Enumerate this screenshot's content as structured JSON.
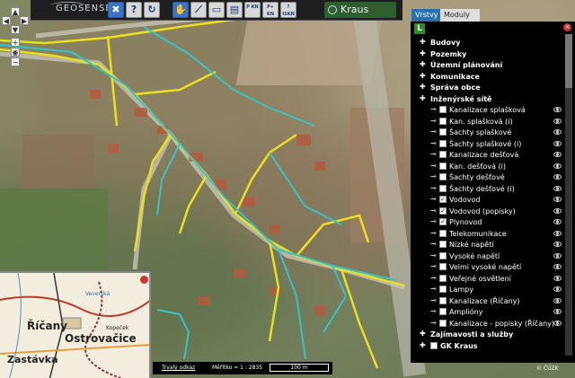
{
  "toolbar": {
    "logo": "GEOSENSE",
    "brand": "Kraus",
    "buttons": [
      {
        "name": "tools-button",
        "label": "✖"
      },
      {
        "name": "help-button",
        "label": "?"
      },
      {
        "name": "refresh-button",
        "label": "↻"
      },
      {
        "name": "pan-button",
        "label": "✋"
      },
      {
        "name": "measure-button",
        "label": "⟋"
      },
      {
        "name": "area-button",
        "label": "▭"
      },
      {
        "name": "print-button",
        "label": "▤"
      },
      {
        "name": "parcel-kn-button",
        "label": "P KN"
      },
      {
        "name": "parcel-plus-kn-button",
        "label": "P+ KN"
      },
      {
        "name": "iskn-button",
        "label": "? ISKN"
      }
    ]
  },
  "tabs": {
    "layers": "Vrstvy",
    "modules": "Moduly"
  },
  "panel": {
    "rows": [
      {
        "label": "Budovy",
        "level": 0,
        "bold": true
      },
      {
        "label": "Pozemky",
        "level": 0,
        "bold": true
      },
      {
        "label": "Územní plánování",
        "level": 0,
        "bold": true
      },
      {
        "label": "Komunikace",
        "level": 0,
        "bold": true
      },
      {
        "label": "Správa obce",
        "level": 0,
        "bold": true
      },
      {
        "label": "Inženýrské sítě",
        "level": 1,
        "bold": true
      },
      {
        "label": "Kanalizace splašková",
        "level": 2,
        "checked": false,
        "eye": true
      },
      {
        "label": "Kan. splašková (i)",
        "level": 2,
        "checked": false,
        "eye": true
      },
      {
        "label": "Šachty splaškové",
        "level": 2,
        "checked": false,
        "eye": true
      },
      {
        "label": "Šachty splaškové (i)",
        "level": 2,
        "checked": false,
        "eye": true
      },
      {
        "label": "Kanalizace dešťová",
        "level": 2,
        "checked": false,
        "eye": true
      },
      {
        "label": "Kan. dešťová (i)",
        "level": 2,
        "checked": false,
        "eye": true
      },
      {
        "label": "Šachty dešťové",
        "level": 2,
        "checked": false,
        "eye": true
      },
      {
        "label": "Šachty dešťové (i)",
        "level": 2,
        "checked": false,
        "eye": true
      },
      {
        "label": "Vodovod",
        "level": 2,
        "checked": true,
        "eye": true
      },
      {
        "label": "Vodovod (popisky)",
        "level": 2,
        "checked": true,
        "eye": true
      },
      {
        "label": "Plynovod",
        "level": 2,
        "checked": true,
        "eye": true
      },
      {
        "label": "Telekomunikace",
        "level": 2,
        "checked": false,
        "eye": true
      },
      {
        "label": "Nízké napětí",
        "level": 2,
        "checked": false,
        "eye": true
      },
      {
        "label": "Vysoké napětí",
        "level": 2,
        "checked": false,
        "eye": true
      },
      {
        "label": "Velmi vysoké napětí",
        "level": 2,
        "checked": false,
        "eye": true
      },
      {
        "label": "Veřejné osvětlení",
        "level": 2,
        "checked": false,
        "eye": true
      },
      {
        "label": "Lampy",
        "level": 2,
        "checked": false,
        "eye": true
      },
      {
        "label": "Kanalizace (Říčany)",
        "level": 2,
        "checked": false,
        "eye": true
      },
      {
        "label": "Amplióny",
        "level": 2,
        "checked": false,
        "eye": true
      },
      {
        "label": "Kanalizace - popisky (Říčany)",
        "level": 2,
        "checked": false,
        "eye": true
      },
      {
        "label": "Zajímavosti a služby",
        "level": 0,
        "bold": true
      },
      {
        "label": "GK Kraus",
        "level": 0,
        "bold": true,
        "checked": false
      }
    ]
  },
  "statusbar": {
    "permalink": "Trvalý odkaz",
    "scale_label": "Měřítko = 1 : 2835",
    "scalebar": "100 m"
  },
  "copyright": "© ČÚZK",
  "overview": {
    "labels": [
      "Říčany",
      "Ostrovačice",
      "Zastávka",
      "Kopeček",
      "Veverská"
    ]
  },
  "colors": {
    "water": "#38c2c8",
    "gas": "#e8e020",
    "panel_bg": "#000000",
    "tab_active": "#2a6fb0"
  }
}
